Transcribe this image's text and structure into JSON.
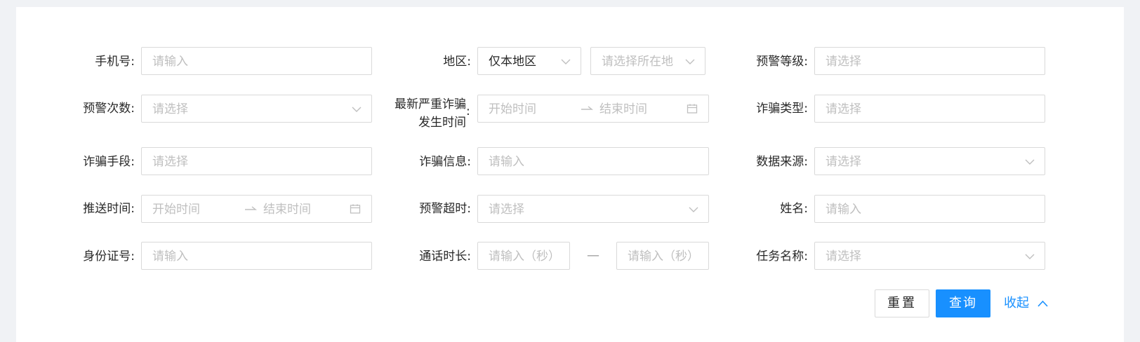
{
  "form": {
    "phone": {
      "label": "手机号:",
      "placeholder": "请输入"
    },
    "region": {
      "label": "地区:",
      "mode_value": "仅本地区",
      "location_placeholder": "请选择所在地"
    },
    "warning_level": {
      "label": "预警等级:",
      "placeholder": "请选择"
    },
    "warning_count": {
      "label": "预警次数:",
      "placeholder": "请选择"
    },
    "latest_fraud_time": {
      "label_line1": "最新严重诈骗",
      "label_line2": "发生时间",
      "colon": ":",
      "start_placeholder": "开始时间",
      "end_placeholder": "结束时间"
    },
    "fraud_type": {
      "label": "诈骗类型:",
      "placeholder": "请选择"
    },
    "fraud_method": {
      "label": "诈骗手段:",
      "placeholder": "请选择"
    },
    "fraud_info": {
      "label": "诈骗信息:",
      "placeholder": "请输入"
    },
    "data_source": {
      "label": "数据来源:",
      "placeholder": "请选择"
    },
    "push_time": {
      "label": "推送时间:",
      "start_placeholder": "开始时间",
      "end_placeholder": "结束时间"
    },
    "warning_timeout": {
      "label": "预警超时:",
      "placeholder": "请选择"
    },
    "name": {
      "label": "姓名:",
      "placeholder": "请输入"
    },
    "id_number": {
      "label": "身份证号:",
      "placeholder": "请输入"
    },
    "call_duration": {
      "label": "通话时长:",
      "min_placeholder": "请输入（秒）",
      "separator": "—",
      "max_placeholder": "请输入（秒）"
    },
    "task_name": {
      "label": "任务名称:",
      "placeholder": "请选择"
    }
  },
  "actions": {
    "reset_label": "重置",
    "query_label": "查询",
    "collapse_label": "收起"
  },
  "colors": {
    "primary": "#1890ff",
    "border": "#d9d9d9",
    "placeholder": "#bfbfbf",
    "page_bg": "#f0f2f5"
  }
}
